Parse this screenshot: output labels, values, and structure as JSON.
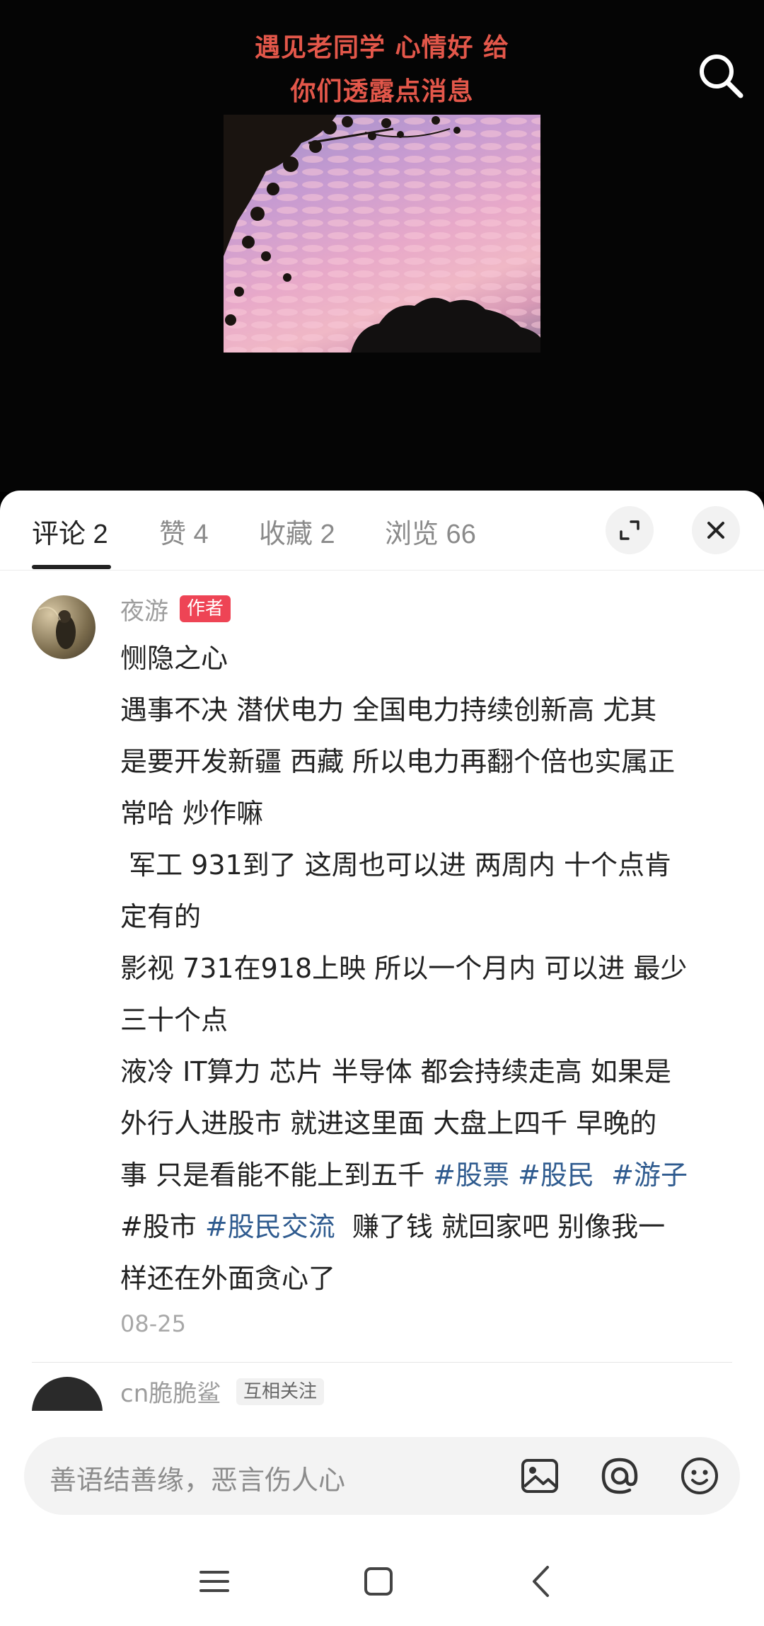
{
  "media": {
    "caption_line1": "遇见老同学 心情好 给",
    "caption_line2": "你们透露点消息"
  },
  "tabs": [
    {
      "label": "评论 2",
      "active": true
    },
    {
      "label": "赞 4",
      "active": false
    },
    {
      "label": "收藏 2",
      "active": false
    },
    {
      "label": "浏览 66",
      "active": false
    }
  ],
  "comments": [
    {
      "username": "夜游",
      "badge": "作者",
      "lines": [
        "恻隐之心",
        "遇事不决 潜伏电力 全国电力持续创新高 尤其",
        "是要开发新疆 西藏 所以电力再翻个倍也实属正",
        "常哈 炒作嘛",
        " 军工 931到了 这周也可以进 两周内 十个点肯",
        "定有的",
        "影视 731在918上映 所以一个月内 可以进 最少",
        "三十个点",
        "液冷 IT算力 芯片 半导体 都会持续走高 如果是",
        "外行人进股市 就进这里面 大盘上四千 早晚的"
      ],
      "line11_text": "事 只是看能不能上到五千 ",
      "tags_line11": [
        "#股票",
        "#股民",
        "#游子"
      ],
      "line12_text_a": "#股市 ",
      "line12_tag": "#股民交流",
      "line12_text_b": "  赚了钱 就回家吧 别像我一",
      "line13": "样还在外面贪心了",
      "date": "08-25"
    },
    {
      "username": "cn脆脆鲨",
      "badge": "互相关注"
    }
  ],
  "input": {
    "placeholder": "善语结善缘，恶言伤人心"
  },
  "icons": {
    "search": "search-icon",
    "expand": "expand-icon",
    "close": "close-icon",
    "image": "image-icon",
    "mention": "at-icon",
    "emoji": "emoji-icon",
    "menu": "menu-icon",
    "home": "home-icon",
    "back": "back-icon"
  },
  "colors": {
    "caption": "#e3574a",
    "author_badge": "#ee4455",
    "hashtag": "#2f5b8f"
  }
}
